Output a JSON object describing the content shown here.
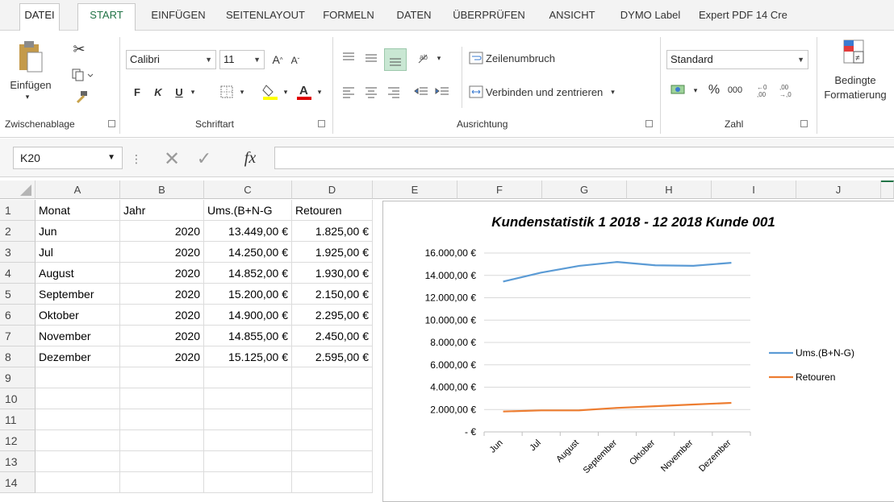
{
  "ribbon_tabs": [
    "DATEI",
    "START",
    "EINFÜGEN",
    "SEITENLAYOUT",
    "FORMELN",
    "DATEN",
    "ÜBERPRÜFEN",
    "ANSICHT",
    "DYMO Label",
    "Expert PDF 14 Cre"
  ],
  "clipboard": {
    "paste_label": "Einfügen",
    "group_label": "Zwischenablage"
  },
  "font": {
    "name": "Calibri",
    "size": "11",
    "bold": "F",
    "italic": "K",
    "underline": "U",
    "group_label": "Schriftart"
  },
  "alignment": {
    "wrap_label": "Zeilenumbruch",
    "merge_label": "Verbinden und zentrieren",
    "group_label": "Ausrichtung"
  },
  "number": {
    "format": "Standard",
    "percent": "%",
    "thousands": "000",
    "group_label": "Zahl"
  },
  "styles": {
    "cond_format_line1": "Bedingte",
    "cond_format_line2": "Formatierung"
  },
  "formula_bar": {
    "name_box": "K20",
    "fx": "fx",
    "value": ""
  },
  "columns": [
    "A",
    "B",
    "C",
    "D",
    "E",
    "F",
    "G",
    "H",
    "I",
    "J"
  ],
  "rows": [
    "1",
    "2",
    "3",
    "4",
    "5",
    "6",
    "7",
    "8",
    "9",
    "10",
    "11",
    "12",
    "13",
    "14"
  ],
  "table": {
    "headers": [
      "Monat",
      "Jahr",
      "Ums.(B+N-G",
      "Retouren"
    ],
    "rows": [
      [
        "Jun",
        "2020",
        "13.449,00 €",
        "1.825,00 €"
      ],
      [
        "Jul",
        "2020",
        "14.250,00 €",
        "1.925,00 €"
      ],
      [
        "August",
        "2020",
        "14.852,00 €",
        "1.930,00 €"
      ],
      [
        "September",
        "2020",
        "15.200,00 €",
        "2.150,00 €"
      ],
      [
        "Oktober",
        "2020",
        "14.900,00 €",
        "2.295,00 €"
      ],
      [
        "November",
        "2020",
        "14.855,00 €",
        "2.450,00 €"
      ],
      [
        "Dezember",
        "2020",
        "15.125,00 €",
        "2.595,00 €"
      ]
    ]
  },
  "colors": {
    "accent": "#217346",
    "series1": "#5b9bd5",
    "series2": "#ed7d31"
  },
  "chart_data": {
    "type": "line",
    "title": "Kundenstatistik 1 2018 - 12 2018 Kunde 001",
    "categories": [
      "Jun",
      "Jul",
      "August",
      "September",
      "Oktober",
      "November",
      "Dezember"
    ],
    "series": [
      {
        "name": "Ums.(B+N-G)",
        "color": "#5b9bd5",
        "values": [
          13449,
          14250,
          14852,
          15200,
          14900,
          14855,
          15125
        ]
      },
      {
        "name": "Retouren",
        "color": "#ed7d31",
        "values": [
          1825,
          1925,
          1930,
          2150,
          2295,
          2450,
          2595
        ]
      }
    ],
    "ylim": [
      0,
      16000
    ],
    "yticks": [
      16000,
      14000,
      12000,
      10000,
      8000,
      6000,
      4000,
      2000,
      0
    ],
    "ytick_labels": [
      "16.000,00 €",
      "14.000,00 €",
      "12.000,00 €",
      "10.000,00 €",
      "8.000,00 €",
      "6.000,00 €",
      "4.000,00 €",
      "2.000,00 €",
      "-   €"
    ],
    "legend": "right",
    "grid": true
  }
}
